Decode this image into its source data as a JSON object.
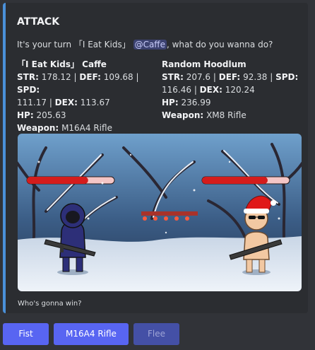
{
  "embed": {
    "title": "ATTACK",
    "desc_prefix": "It's your turn ",
    "mention_role": "「I Eat Kids」",
    "mention_user": "@Caffe",
    "desc_suffix": ", what do you wanna do?",
    "accent_color": "#4a90d9"
  },
  "players": [
    {
      "name": "「I Eat Kids」 Caffe",
      "str_label": "STR:",
      "str": "178.12",
      "def_label": "DEF:",
      "def": "109.68",
      "spd_label": "SPD:",
      "spd": "111.17",
      "dex_label": "DEX:",
      "dex": "113.67",
      "hp_label": "HP:",
      "hp": "205.63",
      "weapon_label": "Weapon:",
      "weapon": "M16A4 Rifle",
      "health_fraction": 0.7
    },
    {
      "name": "Random Hoodlum",
      "str_label": "STR:",
      "str": "207.6",
      "def_label": "DEF:",
      "def": "92.38",
      "spd_label": "SPD:",
      "spd": "116.46",
      "dex_label": "DEX:",
      "dex": "120.24",
      "hp_label": "HP:",
      "hp": "236.99",
      "weapon_label": "Weapon:",
      "weapon": "XM8 Rifle",
      "health_fraction": 0.75
    }
  ],
  "footer": "Who's gonna win?",
  "buttons": [
    {
      "label": "Fist",
      "disabled": false
    },
    {
      "label": "M16A4 Rifle",
      "disabled": false
    },
    {
      "label": "Flee",
      "disabled": true
    }
  ],
  "colors": {
    "health_fill": "#d41c1c",
    "health_empty": "#f4c6c6",
    "button": "#5865f2",
    "button_disabled": "#4450a6"
  }
}
